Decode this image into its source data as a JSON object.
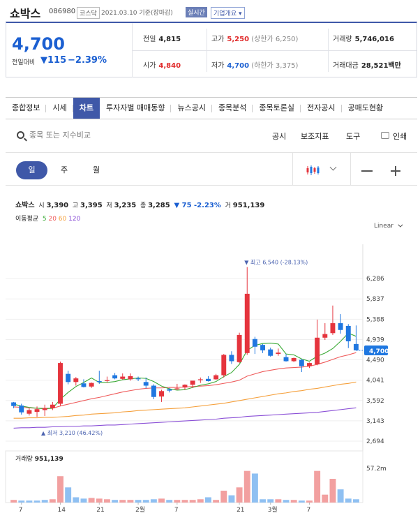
{
  "header": {
    "name": "쇼박스",
    "code": "086980",
    "market_badge": "코스닥",
    "date": "2021.03.10 기준(장마감)",
    "live_badge": "실시간",
    "overview": "기업개요"
  },
  "quote": {
    "price": "4,700",
    "compare_label": "전일대비",
    "change_arrow": "▼",
    "change": "115",
    "change_pct": "−2.39%",
    "stats": {
      "prev_label": "전일",
      "prev": "4,815",
      "high_label": "고가",
      "high": "5,250",
      "upper_limit": "(상한가 6,250)",
      "volume_label": "거래량",
      "volume": "5,746,016",
      "open_label": "시가",
      "open": "4,840",
      "low_label": "저가",
      "low": "4,700",
      "lower_limit": "(하한가 3,375)",
      "value_label": "거래대금",
      "value": "28,521백만"
    }
  },
  "tabs": [
    "종합정보",
    "시세",
    "차트",
    "투자자별 매매동향",
    "뉴스공시",
    "종목분석",
    "종목토론실",
    "전자공시",
    "공매도현황"
  ],
  "active_tab": "차트",
  "toolbar": {
    "search_placeholder": "종목 또는 지수비교",
    "disclosure": "공시",
    "indicators": "보조지표",
    "tools": "도구",
    "print": "인쇄"
  },
  "periods": [
    "일",
    "주",
    "월"
  ],
  "legend": {
    "name": "쇼박스",
    "open_label": "시",
    "open": "3,390",
    "high_label": "고",
    "high": "3,395",
    "low_label": "저",
    "low": "3,235",
    "close_label": "종",
    "close": "3,285",
    "change": "▼ 75 -2.23%",
    "volume_label": "거",
    "volume": "951,139",
    "ma_label": "이동평균",
    "ma": [
      "5",
      "20",
      "60",
      "120"
    ],
    "scale": "Linear"
  },
  "volume_legend": {
    "label": "거래량",
    "value": "951,139"
  },
  "colors": {
    "up": "#e5343d",
    "down": "#1f77e0",
    "ma5": "#3aaa35",
    "ma20": "#ef5b5b",
    "ma60": "#f5a03c",
    "ma120": "#8a4fd6",
    "accent": "#3f58a8"
  },
  "chart_data": {
    "type": "candlestick",
    "price_axis": [
      "6,286",
      "5,837",
      "5,388",
      "4,939",
      "4,490",
      "4,041",
      "3,592",
      "3,143",
      "2,694"
    ],
    "ylim": [
      2694,
      6735
    ],
    "current_price_label": "4,700",
    "annotations": {
      "max": "▼ 최고 6,540 (-28.13%)",
      "min": "▲ 최저 3,210 (46.42%)"
    },
    "x_ticks": [
      "7",
      "14",
      "21",
      "2월",
      "7",
      "21",
      "3월",
      "7"
    ],
    "candles": [
      {
        "o": 3550,
        "h": 3560,
        "l": 3420,
        "c": 3470
      },
      {
        "o": 3480,
        "h": 3520,
        "l": 3280,
        "c": 3330
      },
      {
        "o": 3300,
        "h": 3420,
        "l": 3260,
        "c": 3380
      },
      {
        "o": 3340,
        "h": 3460,
        "l": 3230,
        "c": 3400
      },
      {
        "o": 3380,
        "h": 3500,
        "l": 3250,
        "c": 3420
      },
      {
        "o": 3420,
        "h": 3560,
        "l": 3380,
        "c": 3500
      },
      {
        "o": 3520,
        "h": 4450,
        "l": 3480,
        "c": 4420
      },
      {
        "o": 4180,
        "h": 4250,
        "l": 3950,
        "c": 4000
      },
      {
        "o": 4000,
        "h": 4110,
        "l": 3920,
        "c": 4080
      },
      {
        "o": 3970,
        "h": 4060,
        "l": 3880,
        "c": 3890
      },
      {
        "o": 3900,
        "h": 3990,
        "l": 3870,
        "c": 3980
      },
      {
        "o": 4020,
        "h": 4250,
        "l": 3960,
        "c": 4000
      },
      {
        "o": 4040,
        "h": 4120,
        "l": 3980,
        "c": 4040
      },
      {
        "o": 4150,
        "h": 4200,
        "l": 4060,
        "c": 4080
      },
      {
        "o": 4070,
        "h": 4190,
        "l": 4050,
        "c": 4120
      },
      {
        "o": 4060,
        "h": 4190,
        "l": 4030,
        "c": 4130
      },
      {
        "o": 4080,
        "h": 4120,
        "l": 4020,
        "c": 4070
      },
      {
        "o": 4000,
        "h": 4100,
        "l": 3860,
        "c": 3920
      },
      {
        "o": 3920,
        "h": 3950,
        "l": 3620,
        "c": 3670
      },
      {
        "o": 3680,
        "h": 3830,
        "l": 3560,
        "c": 3800
      },
      {
        "o": 3840,
        "h": 3870,
        "l": 3770,
        "c": 3810
      },
      {
        "o": 3850,
        "h": 3960,
        "l": 3820,
        "c": 3860
      },
      {
        "o": 3880,
        "h": 3950,
        "l": 3830,
        "c": 3940
      },
      {
        "o": 3940,
        "h": 4000,
        "l": 3870,
        "c": 4030
      },
      {
        "o": 4040,
        "h": 4100,
        "l": 3980,
        "c": 4060
      },
      {
        "o": 4070,
        "h": 4130,
        "l": 4010,
        "c": 4020
      },
      {
        "o": 4060,
        "h": 4180,
        "l": 4050,
        "c": 4150
      },
      {
        "o": 4150,
        "h": 4620,
        "l": 4100,
        "c": 4600
      },
      {
        "o": 4600,
        "h": 4680,
        "l": 4400,
        "c": 4460
      },
      {
        "o": 4440,
        "h": 5090,
        "l": 4420,
        "c": 5040
      },
      {
        "o": 4640,
        "h": 6540,
        "l": 4600,
        "c": 5950
      },
      {
        "o": 4950,
        "h": 5000,
        "l": 4620,
        "c": 4780
      },
      {
        "o": 4820,
        "h": 4840,
        "l": 4640,
        "c": 4700
      },
      {
        "o": 4720,
        "h": 4760,
        "l": 4560,
        "c": 4580
      },
      {
        "o": 4620,
        "h": 4740,
        "l": 4580,
        "c": 4650
      },
      {
        "o": 4550,
        "h": 4620,
        "l": 4450,
        "c": 4460
      },
      {
        "o": 4460,
        "h": 4540,
        "l": 4440,
        "c": 4530
      },
      {
        "o": 4490,
        "h": 4510,
        "l": 4220,
        "c": 4350
      },
      {
        "o": 4350,
        "h": 4430,
        "l": 4310,
        "c": 4420
      },
      {
        "o": 4390,
        "h": 5380,
        "l": 4370,
        "c": 4980
      },
      {
        "o": 4980,
        "h": 5300,
        "l": 4930,
        "c": 5060
      },
      {
        "o": 5080,
        "h": 5690,
        "l": 5040,
        "c": 5300
      },
      {
        "o": 5300,
        "h": 5500,
        "l": 5070,
        "c": 5150
      },
      {
        "o": 5240,
        "h": 5280,
        "l": 4750,
        "c": 4900
      },
      {
        "o": 4840,
        "h": 5250,
        "l": 4700,
        "c": 4700
      }
    ],
    "ma5": [
      3510,
      3470,
      3440,
      3420,
      3410,
      3420,
      3620,
      3770,
      3900,
      3990,
      4090,
      3990,
      3990,
      4010,
      4050,
      4070,
      4090,
      4080,
      4010,
      3910,
      3850,
      3820,
      3830,
      3880,
      3930,
      3960,
      4010,
      4120,
      4210,
      4390,
      4700,
      4810,
      4850,
      4860,
      4840,
      4620,
      4600,
      4510,
      4460,
      4570,
      4640,
      4740,
      4900,
      5080,
      5010
    ],
    "ma20": [
      3450,
      3440,
      3430,
      3420,
      3420,
      3420,
      3470,
      3510,
      3550,
      3590,
      3630,
      3660,
      3700,
      3740,
      3780,
      3810,
      3840,
      3860,
      3870,
      3870,
      3880,
      3880,
      3890,
      3900,
      3910,
      3920,
      3940,
      3970,
      4000,
      4040,
      4130,
      4180,
      4230,
      4260,
      4290,
      4310,
      4320,
      4330,
      4350,
      4390,
      4440,
      4500,
      4560,
      4600,
      4650
    ],
    "ma60": [
      3200,
      3200,
      3210,
      3210,
      3220,
      3220,
      3230,
      3240,
      3260,
      3270,
      3290,
      3300,
      3310,
      3320,
      3340,
      3350,
      3370,
      3380,
      3390,
      3400,
      3410,
      3420,
      3430,
      3450,
      3470,
      3490,
      3510,
      3530,
      3560,
      3590,
      3620,
      3650,
      3680,
      3710,
      3740,
      3760,
      3790,
      3810,
      3840,
      3860,
      3890,
      3920,
      3950,
      3970,
      4000
    ],
    "ma120": [
      2980,
      2990,
      2990,
      3000,
      3000,
      3010,
      3010,
      3020,
      3020,
      3030,
      3030,
      3040,
      3050,
      3050,
      3060,
      3070,
      3080,
      3090,
      3100,
      3110,
      3120,
      3130,
      3140,
      3150,
      3160,
      3170,
      3180,
      3200,
      3210,
      3220,
      3240,
      3250,
      3260,
      3270,
      3280,
      3290,
      3300,
      3310,
      3320,
      3330,
      3350,
      3370,
      3390,
      3410,
      3430
    ],
    "volume_axis": "57.2m",
    "volume_max": 72,
    "volumes": [
      {
        "v": 4,
        "up": true
      },
      {
        "v": 3,
        "up": false
      },
      {
        "v": 3,
        "up": false
      },
      {
        "v": 3,
        "up": false
      },
      {
        "v": 4,
        "up": false
      },
      {
        "v": 5,
        "up": true
      },
      {
        "v": 40,
        "up": true
      },
      {
        "v": 23,
        "up": false
      },
      {
        "v": 8,
        "up": false
      },
      {
        "v": 6,
        "up": false
      },
      {
        "v": 7,
        "up": true
      },
      {
        "v": 6,
        "up": true
      },
      {
        "v": 5,
        "up": true
      },
      {
        "v": 4,
        "up": false
      },
      {
        "v": 4,
        "up": true
      },
      {
        "v": 4,
        "up": true
      },
      {
        "v": 4,
        "up": false
      },
      {
        "v": 4,
        "up": false
      },
      {
        "v": 5,
        "up": false
      },
      {
        "v": 6,
        "up": true
      },
      {
        "v": 4,
        "up": false
      },
      {
        "v": 4,
        "up": true
      },
      {
        "v": 4,
        "up": true
      },
      {
        "v": 4,
        "up": true
      },
      {
        "v": 5,
        "up": true
      },
      {
        "v": 8,
        "up": false
      },
      {
        "v": 4,
        "up": true
      },
      {
        "v": 18,
        "up": true
      },
      {
        "v": 11,
        "up": false
      },
      {
        "v": 23,
        "up": true
      },
      {
        "v": 48,
        "up": true
      },
      {
        "v": 44,
        "up": false
      },
      {
        "v": 5,
        "up": false
      },
      {
        "v": 5,
        "up": false
      },
      {
        "v": 5,
        "up": true
      },
      {
        "v": 4,
        "up": false
      },
      {
        "v": 4,
        "up": true
      },
      {
        "v": 3,
        "up": false
      },
      {
        "v": 3,
        "up": true
      },
      {
        "v": 48,
        "up": true
      },
      {
        "v": 12,
        "up": true
      },
      {
        "v": 36,
        "up": true
      },
      {
        "v": 20,
        "up": false
      },
      {
        "v": 6,
        "up": false
      },
      {
        "v": 5,
        "up": false
      }
    ]
  }
}
